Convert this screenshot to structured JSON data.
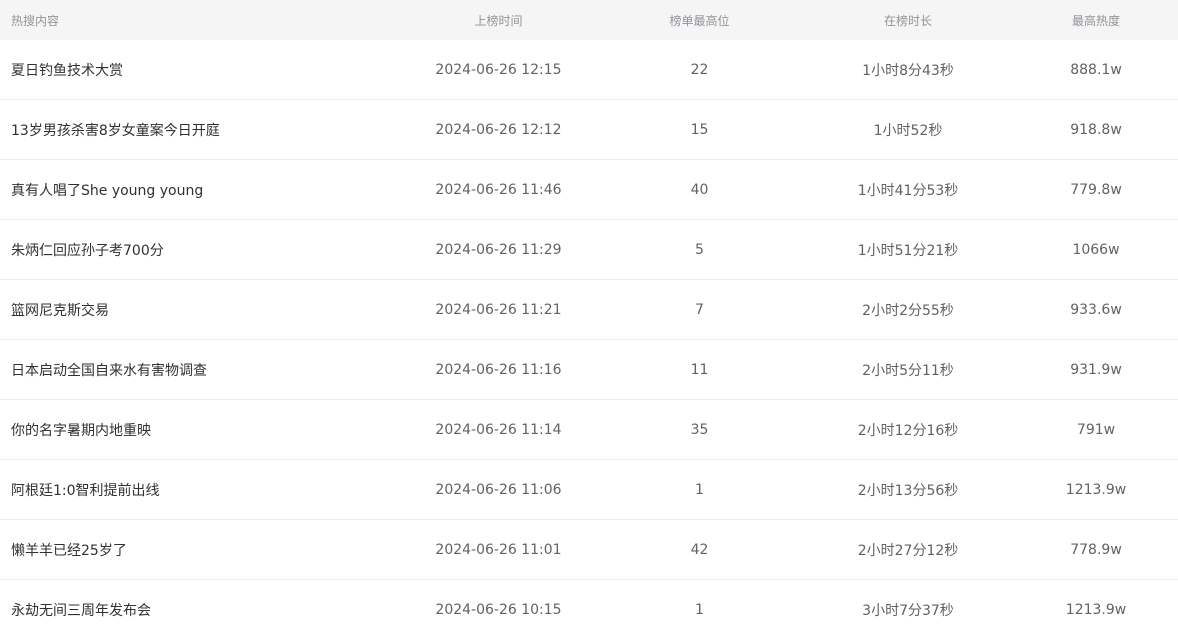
{
  "columns": {
    "title": "热搜内容",
    "time": "上榜时间",
    "rank": "榜单最高位",
    "duration": "在榜时长",
    "heat": "最高热度"
  },
  "rows": [
    {
      "title": "夏日钓鱼技术大赏",
      "time": "2024-06-26 12:15",
      "rank": "22",
      "duration": "1小时8分43秒",
      "heat": "888.1w"
    },
    {
      "title": "13岁男孩杀害8岁女童案今日开庭",
      "time": "2024-06-26 12:12",
      "rank": "15",
      "duration": "1小时52秒",
      "heat": "918.8w"
    },
    {
      "title": "真有人唱了She young young",
      "time": "2024-06-26 11:46",
      "rank": "40",
      "duration": "1小时41分53秒",
      "heat": "779.8w"
    },
    {
      "title": "朱炳仁回应孙子考700分",
      "time": "2024-06-26 11:29",
      "rank": "5",
      "duration": "1小时51分21秒",
      "heat": "1066w"
    },
    {
      "title": "篮网尼克斯交易",
      "time": "2024-06-26 11:21",
      "rank": "7",
      "duration": "2小时2分55秒",
      "heat": "933.6w"
    },
    {
      "title": "日本启动全国自来水有害物调查",
      "time": "2024-06-26 11:16",
      "rank": "11",
      "duration": "2小时5分11秒",
      "heat": "931.9w"
    },
    {
      "title": "你的名字暑期内地重映",
      "time": "2024-06-26 11:14",
      "rank": "35",
      "duration": "2小时12分16秒",
      "heat": "791w"
    },
    {
      "title": "阿根廷1:0智利提前出线",
      "time": "2024-06-26 11:06",
      "rank": "1",
      "duration": "2小时13分56秒",
      "heat": "1213.9w"
    },
    {
      "title": "懒羊羊已经25岁了",
      "time": "2024-06-26 11:01",
      "rank": "42",
      "duration": "2小时27分12秒",
      "heat": "778.9w"
    },
    {
      "title": "永劫无间三周年发布会",
      "time": "2024-06-26 10:15",
      "rank": "1",
      "duration": "3小时7分37秒",
      "heat": "1213.9w"
    }
  ]
}
